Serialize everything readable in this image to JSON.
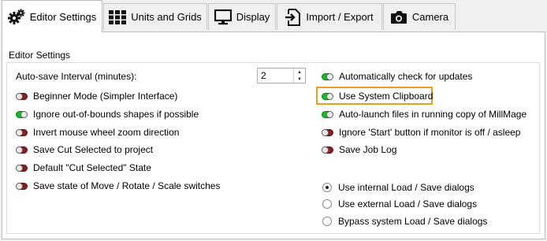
{
  "tabs": [
    {
      "label": "Editor Settings",
      "icon": "gears-icon"
    },
    {
      "label": "Units and Grids",
      "icon": "grid-icon"
    },
    {
      "label": "Display",
      "icon": "monitor-icon"
    },
    {
      "label": "Import / Export",
      "icon": "import-export-icon"
    },
    {
      "label": "Camera",
      "icon": "camera-icon"
    }
  ],
  "active_tab": "Editor Settings",
  "group_title": "Editor Settings",
  "autosave": {
    "label": "Auto-save Interval (minutes):",
    "value": "2"
  },
  "left_options": [
    {
      "label": "Beginner Mode (Simpler Interface)",
      "on": false
    },
    {
      "label": "Ignore out-of-bounds shapes if possible",
      "on": true
    },
    {
      "label": "Invert mouse wheel zoom direction",
      "on": false
    },
    {
      "label": "Save Cut Selected to project",
      "on": false
    },
    {
      "label": "Default \"Cut Selected\" State",
      "on": false
    },
    {
      "label": "Save state of Move / Rotate / Scale switches",
      "on": false
    }
  ],
  "right_options": [
    {
      "label": "Automatically check for updates",
      "on": true
    },
    {
      "label": "Use System Clipboard",
      "on": true
    },
    {
      "label": "Auto-launch files in running copy of MillMage",
      "on": true
    },
    {
      "label": "Ignore 'Start' button if monitor is off / asleep",
      "on": false
    },
    {
      "label": "Save Job Log",
      "on": false
    }
  ],
  "dialog_options": [
    {
      "label": "Use internal Load / Save dialogs",
      "selected": true
    },
    {
      "label": "Use external Load / Save dialogs",
      "selected": false
    },
    {
      "label": "Bypass system Load / Save dialogs",
      "selected": false
    }
  ],
  "colors": {
    "toggle_on": "#1db82a",
    "toggle_off": "#8a1f1f",
    "highlight": "#f29c1f"
  }
}
